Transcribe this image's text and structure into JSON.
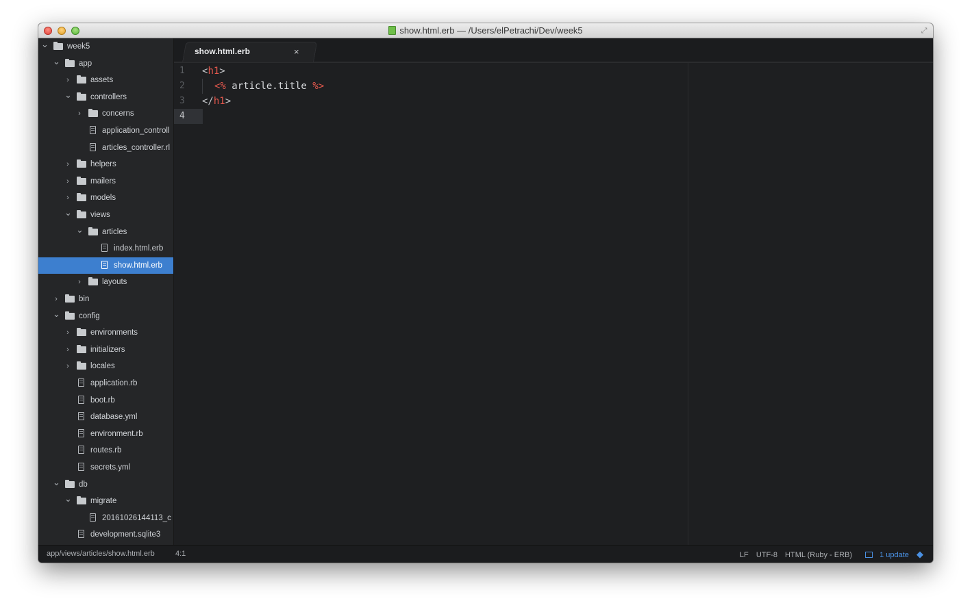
{
  "window": {
    "title": "show.html.erb — /Users/elPetrachi/Dev/week5"
  },
  "sidebar": {
    "items": [
      {
        "label": "week5",
        "type": "folder",
        "depth": 0,
        "expanded": true
      },
      {
        "label": "app",
        "type": "folder",
        "depth": 1,
        "expanded": true
      },
      {
        "label": "assets",
        "type": "folder",
        "depth": 2,
        "expanded": false
      },
      {
        "label": "controllers",
        "type": "folder",
        "depth": 2,
        "expanded": true
      },
      {
        "label": "concerns",
        "type": "folder",
        "depth": 3,
        "expanded": false
      },
      {
        "label": "application_controll",
        "type": "file",
        "depth": 3
      },
      {
        "label": "articles_controller.rl",
        "type": "file",
        "depth": 3
      },
      {
        "label": "helpers",
        "type": "folder",
        "depth": 2,
        "expanded": false
      },
      {
        "label": "mailers",
        "type": "folder",
        "depth": 2,
        "expanded": false
      },
      {
        "label": "models",
        "type": "folder",
        "depth": 2,
        "expanded": false
      },
      {
        "label": "views",
        "type": "folder",
        "depth": 2,
        "expanded": true
      },
      {
        "label": "articles",
        "type": "folder",
        "depth": 3,
        "expanded": true
      },
      {
        "label": "index.html.erb",
        "type": "file",
        "depth": 4
      },
      {
        "label": "show.html.erb",
        "type": "file",
        "depth": 4,
        "selected": true
      },
      {
        "label": "layouts",
        "type": "folder",
        "depth": 3,
        "expanded": false
      },
      {
        "label": "bin",
        "type": "folder",
        "depth": 1,
        "expanded": false
      },
      {
        "label": "config",
        "type": "folder",
        "depth": 1,
        "expanded": true
      },
      {
        "label": "environments",
        "type": "folder",
        "depth": 2,
        "expanded": false
      },
      {
        "label": "initializers",
        "type": "folder",
        "depth": 2,
        "expanded": false
      },
      {
        "label": "locales",
        "type": "folder",
        "depth": 2,
        "expanded": false
      },
      {
        "label": "application.rb",
        "type": "file",
        "depth": 2
      },
      {
        "label": "boot.rb",
        "type": "file",
        "depth": 2
      },
      {
        "label": "database.yml",
        "type": "file",
        "depth": 2
      },
      {
        "label": "environment.rb",
        "type": "file",
        "depth": 2
      },
      {
        "label": "routes.rb",
        "type": "file",
        "depth": 2
      },
      {
        "label": "secrets.yml",
        "type": "file",
        "depth": 2
      },
      {
        "label": "db",
        "type": "folder",
        "depth": 1,
        "expanded": true
      },
      {
        "label": "migrate",
        "type": "folder",
        "depth": 2,
        "expanded": true
      },
      {
        "label": "20161026144113_c",
        "type": "file",
        "depth": 3
      },
      {
        "label": "development.sqlite3",
        "type": "file",
        "depth": 2
      }
    ]
  },
  "tabs": [
    {
      "label": "show.html.erb",
      "close": "×",
      "active": true
    }
  ],
  "editor": {
    "line_numbers": [
      "1",
      "2",
      "3",
      "4"
    ],
    "active_line": 4,
    "lines": [
      {
        "open": "<",
        "tag": "h1",
        "close": ">"
      },
      {
        "erb_open": "<%",
        "expr": " article.title ",
        "erb_close": "%>"
      },
      {
        "open": "</",
        "tag": "h1",
        "close": ">"
      },
      {}
    ]
  },
  "statusbar": {
    "path": "app/views/articles/show.html.erb",
    "cursor": "4:1",
    "line_ending": "LF",
    "encoding": "UTF-8",
    "grammar": "HTML (Ruby - ERB)",
    "update": "1 update"
  },
  "icons": {
    "close": "close-icon",
    "minimize": "minimize-icon",
    "maximize": "maximize-icon",
    "fullscreen": "fullscreen-icon",
    "folder": "folder-icon",
    "file": "file-icon",
    "update": "update-package-icon",
    "squirrel": "squirrel-icon"
  },
  "colors": {
    "accent": "#3d7fcf",
    "tag": "#e4584d",
    "link": "#4a90e2"
  }
}
